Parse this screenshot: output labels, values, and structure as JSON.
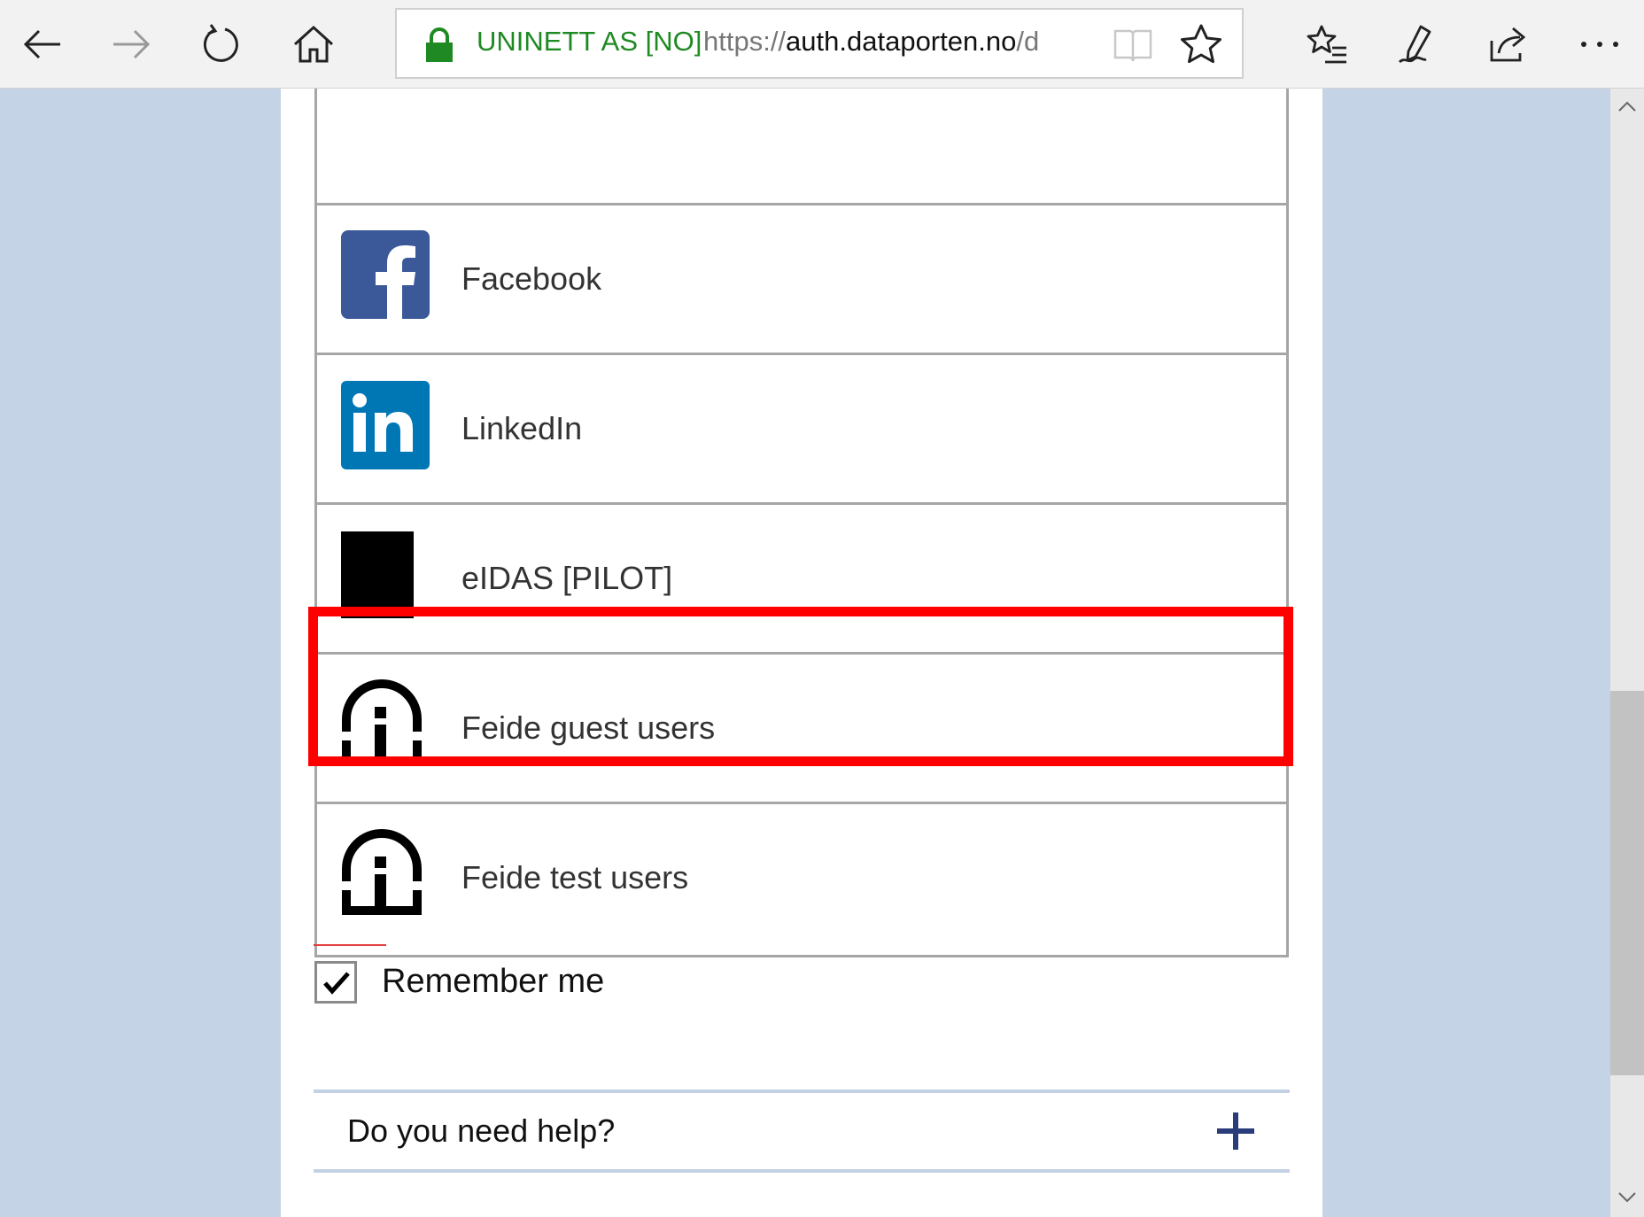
{
  "browser": {
    "site_identity": "UNINETT AS [NO]",
    "url_scheme": "https://",
    "url_domain": "auth.dataporten.no",
    "url_path": "/discovery",
    "accent_color": "#1f8a23"
  },
  "providers": [
    {
      "label": "",
      "icon": "twitter-logo"
    },
    {
      "label": "Facebook",
      "icon": "facebook-logo",
      "color": "#3b5998"
    },
    {
      "label": "LinkedIn",
      "icon": "linkedin-logo",
      "color": "#0077b5"
    },
    {
      "label": "eIDAS [PILOT]",
      "icon": "eidas-logo"
    },
    {
      "label": "Feide guest users",
      "icon": "feide-logo",
      "highlighted": true
    },
    {
      "label": "Feide test users",
      "icon": "feide-logo"
    }
  ],
  "remember": {
    "label": "Remember me",
    "checked": true
  },
  "help": {
    "label": "Do you need help?",
    "icon": "plus-icon"
  }
}
